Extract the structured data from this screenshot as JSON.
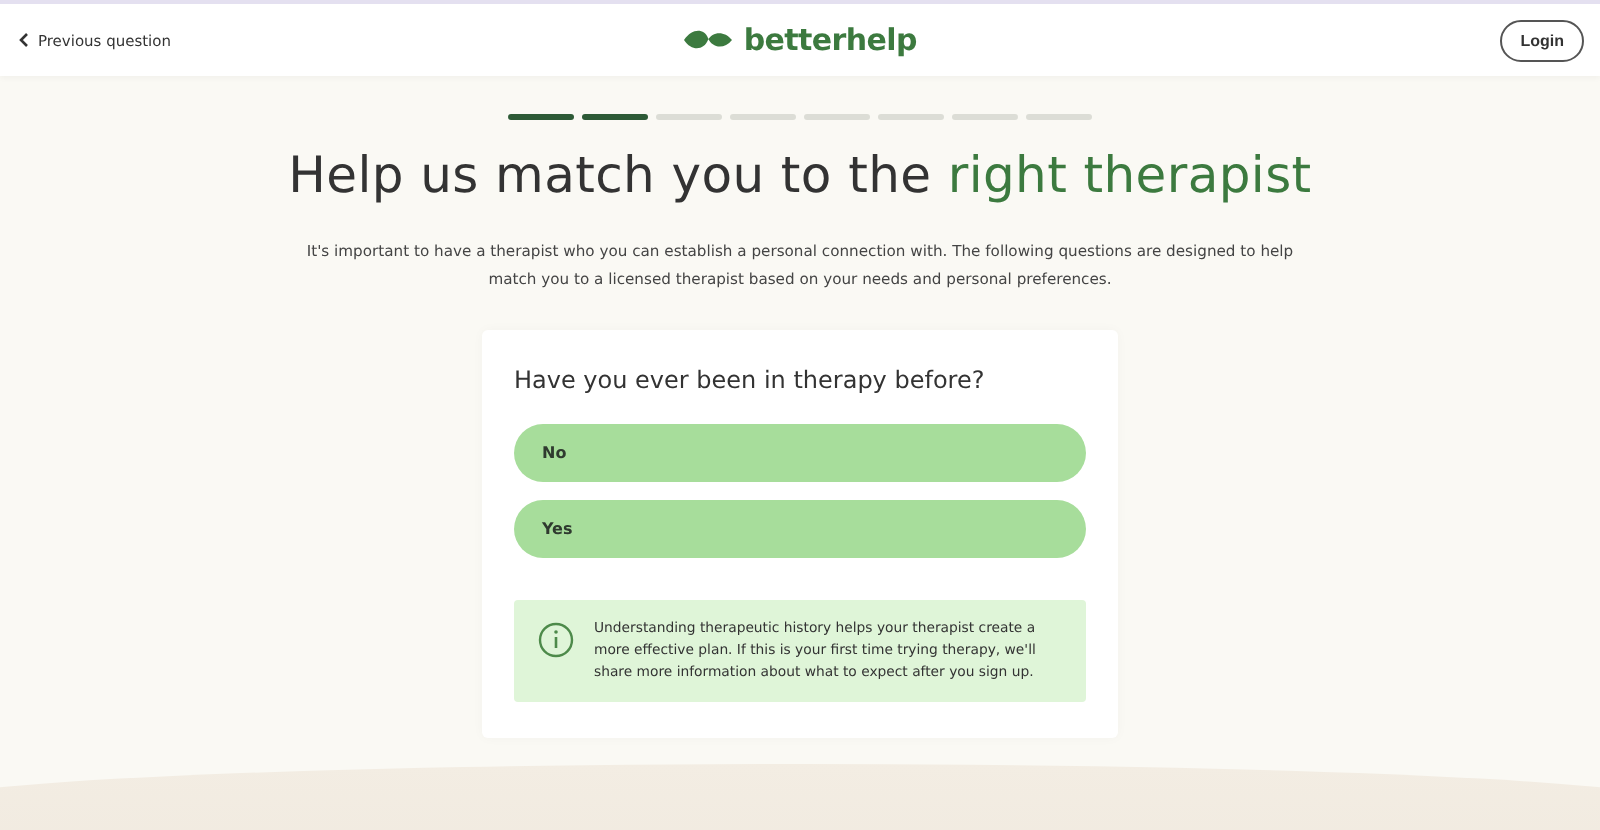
{
  "header": {
    "back_link": "Previous question",
    "logo": "betterhelp",
    "login_button": "Login"
  },
  "progress": {
    "steps": [
      {
        "done": true
      },
      {
        "done": true
      },
      {
        "done": false
      },
      {
        "done": false
      },
      {
        "done": false
      },
      {
        "done": false
      },
      {
        "done": false
      },
      {
        "done": false
      }
    ]
  },
  "title": {
    "text": "Help us match you to the ",
    "highlight": "right therapist"
  },
  "intro": "It's important to have a therapist who you can establish a personal connection with. The following questions are designed to help match you to a licensed therapist based on your needs and personal preferences.",
  "question": {
    "text": "Have you ever been in therapy before?",
    "options": [
      {
        "label": "No",
        "selected": false
      },
      {
        "label": "Yes",
        "selected": false
      }
    ],
    "info": "Understanding therapeutic history helps your therapist create a more effective plan. If this is your first time trying therapy, we'll share more information about what to expect after you sign up."
  }
}
